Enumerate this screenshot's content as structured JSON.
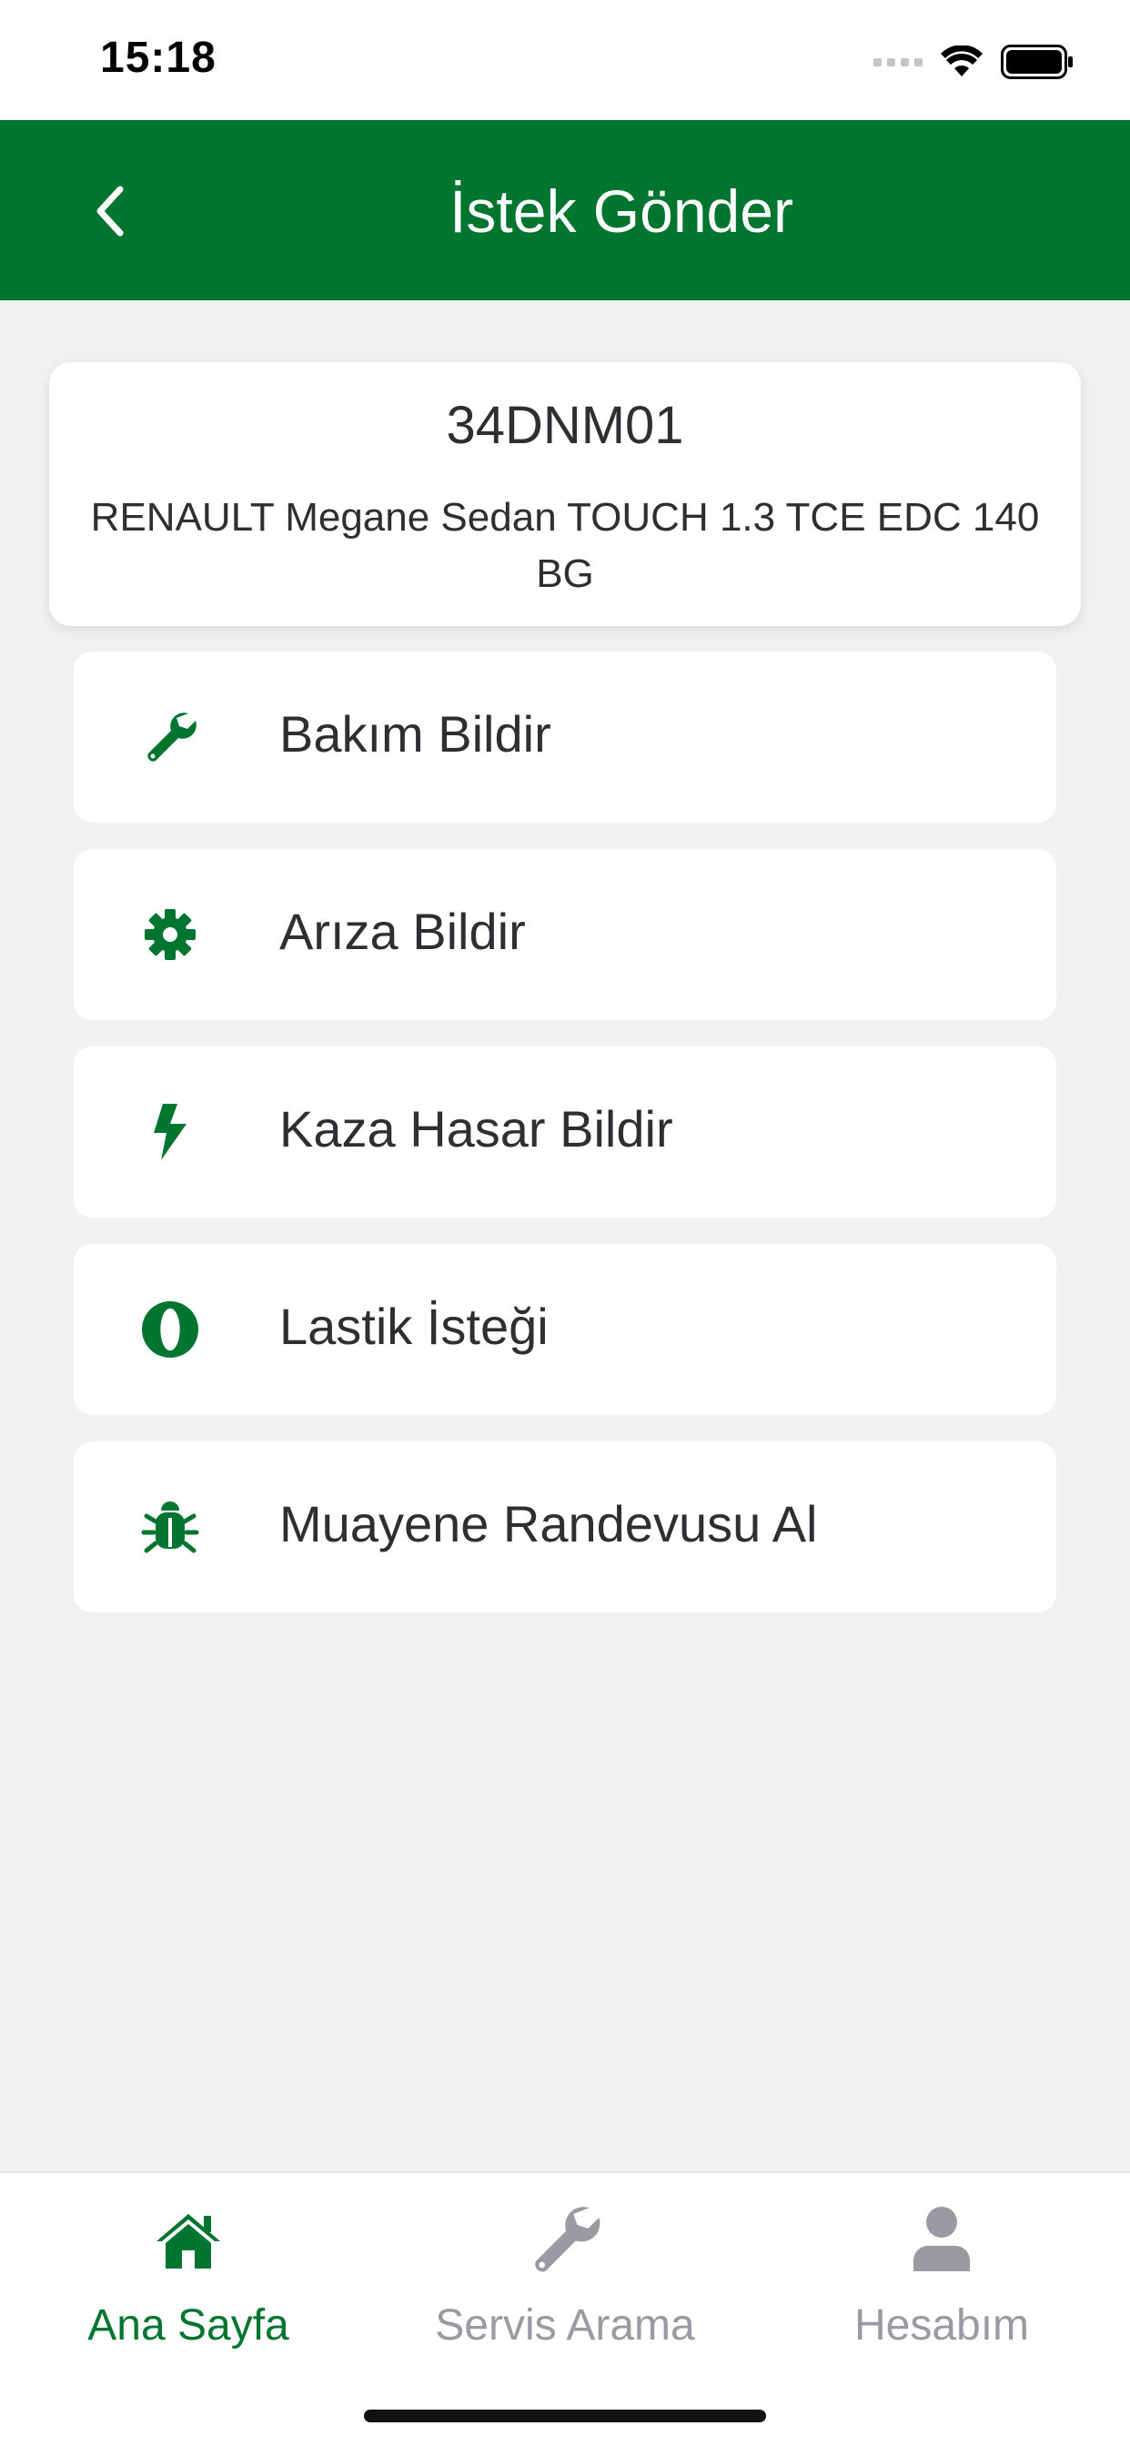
{
  "status_bar": {
    "time": "15:18"
  },
  "header": {
    "title": "İstek Gönder",
    "back_icon": "chevron-left-icon"
  },
  "vehicle": {
    "plate": "34DNM01",
    "model": "RENAULT Megane Sedan TOUCH 1.3 TCE EDC 140 BG"
  },
  "menu": {
    "items": [
      {
        "label": "Bakım Bildir",
        "icon": "wrench-icon"
      },
      {
        "label": "Arıza Bildir",
        "icon": "gear-icon"
      },
      {
        "label": "Kaza Hasar Bildir",
        "icon": "bolt-icon"
      },
      {
        "label": "Lastik İsteği",
        "icon": "tire-icon"
      },
      {
        "label": "Muayene Randevusu Al",
        "icon": "bug-icon"
      }
    ]
  },
  "tab_bar": {
    "tabs": [
      {
        "label": "Ana Sayfa",
        "icon": "home-icon",
        "active": true
      },
      {
        "label": "Servis Arama",
        "icon": "wrench-icon",
        "active": false
      },
      {
        "label": "Hesabım",
        "icon": "user-icon",
        "active": false
      }
    ]
  },
  "colors": {
    "brand_green": "#00752f",
    "inactive_tab": "#9a9aa2",
    "background": "#f1f1f1"
  }
}
